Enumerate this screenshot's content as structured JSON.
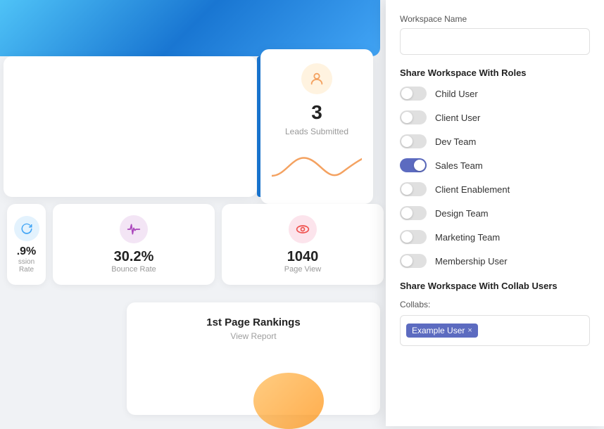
{
  "dashboard": {
    "topGradient": true,
    "leads": {
      "number": "3",
      "label": "Leads Submitted"
    },
    "stats": [
      {
        "number": "9%",
        "prefix": ".",
        "full": ".9%",
        "label": "ssion Rate",
        "iconColor": "#e3f2fd",
        "iconType": "refresh"
      },
      {
        "number": "30.2%",
        "label": "Bounce Rate",
        "iconColor": "#f3e5f5",
        "iconType": "pulse"
      },
      {
        "number": "1040",
        "label": "Page View",
        "iconColor": "#fce4ec",
        "iconType": "eye"
      }
    ],
    "bottomCard": {
      "title": "1st Page Rankings",
      "link": "View Report"
    }
  },
  "modal": {
    "workspaceName": {
      "label": "Workspace Name",
      "value": "",
      "placeholder": ""
    },
    "shareWithRoles": {
      "sectionTitle": "Share Workspace With Roles",
      "roles": [
        {
          "label": "Child User",
          "enabled": false
        },
        {
          "label": "Client User",
          "enabled": false
        },
        {
          "label": "Dev Team",
          "enabled": false
        },
        {
          "label": "Sales Team",
          "enabled": true
        },
        {
          "label": "Client Enablement",
          "enabled": false
        },
        {
          "label": "Design Team",
          "enabled": false
        },
        {
          "label": "Marketing Team",
          "enabled": false
        },
        {
          "label": "Membership User",
          "enabled": false
        }
      ]
    },
    "shareWithCollabs": {
      "sectionTitle": "Share Workspace With Collab Users",
      "collabsLabel": "Collabs:",
      "tags": [
        {
          "label": "Example User"
        }
      ]
    }
  }
}
